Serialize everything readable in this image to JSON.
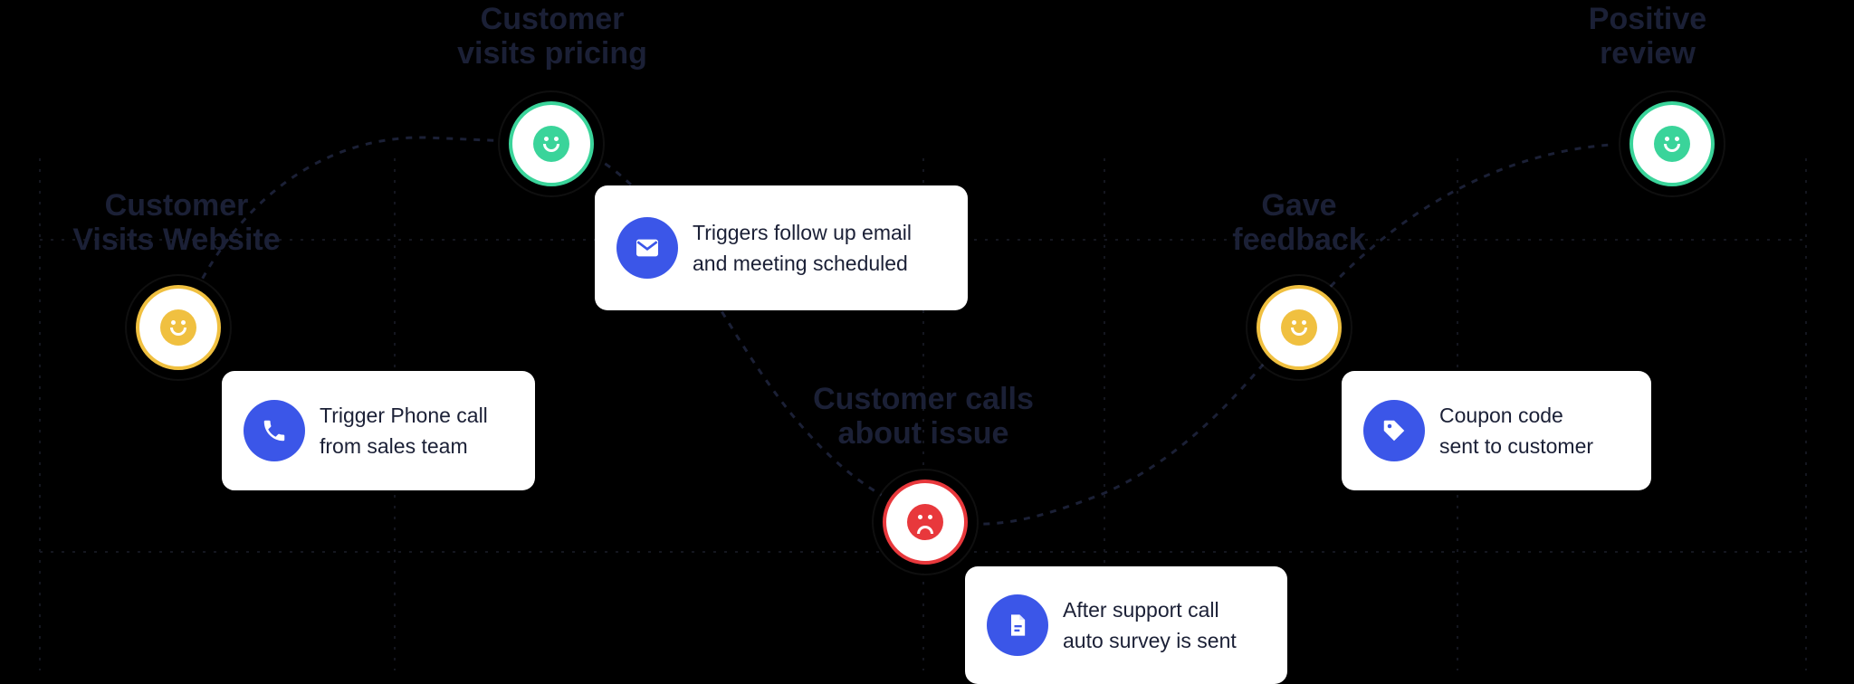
{
  "stages": [
    {
      "id": "visits",
      "label_lines": [
        "Customer",
        "Visits Website"
      ],
      "mood": "neutral"
    },
    {
      "id": "pricing",
      "label_lines": [
        "Customer",
        "visits pricing"
      ],
      "mood": "happy"
    },
    {
      "id": "support",
      "label_lines": [
        "Customer calls",
        "about issue"
      ],
      "mood": "sad"
    },
    {
      "id": "feedback",
      "label_lines": [
        "Gave",
        "feedback"
      ],
      "mood": "neutral"
    },
    {
      "id": "review",
      "label_lines": [
        "Positive",
        "review"
      ],
      "mood": "happy"
    }
  ],
  "actions": [
    {
      "id": "phone",
      "icon": "phone-icon",
      "lines": [
        "Trigger Phone call",
        "from sales team"
      ]
    },
    {
      "id": "email",
      "icon": "envelope-icon",
      "lines": [
        "Triggers follow up email",
        "and meeting scheduled"
      ]
    },
    {
      "id": "survey",
      "icon": "document-icon",
      "lines": [
        "After support call",
        "auto survey is sent"
      ]
    },
    {
      "id": "coupon",
      "icon": "tag-icon",
      "lines": [
        "Coupon code",
        "sent to customer"
      ]
    }
  ],
  "colors": {
    "background": "#000000",
    "happy": "#3ad49a",
    "neutral": "#f0c040",
    "sad": "#e8383c",
    "icon_bg": "#3b56e8",
    "text": "#1b2036",
    "journey_line": "#1b2036"
  }
}
